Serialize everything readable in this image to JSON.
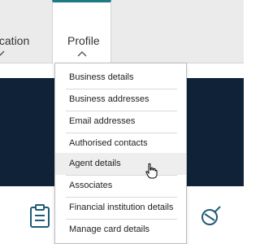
{
  "nav": {
    "tabs": [
      {
        "label": "nication"
      },
      {
        "label": "Profile"
      }
    ]
  },
  "dropdown": {
    "items": [
      {
        "label": "Business details"
      },
      {
        "label": "Business addresses"
      },
      {
        "label": "Email addresses"
      },
      {
        "label": "Authorised contacts"
      },
      {
        "label": "Agent details"
      },
      {
        "label": "Associates"
      },
      {
        "label": "Financial institution details"
      },
      {
        "label": "Manage card details"
      }
    ],
    "hovered_item": "Agent details"
  },
  "icons": {
    "tab_chevrons": [
      "chevron-down-icon",
      "chevron-up-icon"
    ],
    "lower": [
      "clipboard-icon",
      "search-icon"
    ],
    "cursor": "hand-pointer-icon"
  },
  "colors": {
    "active_tab_accent": "#1f7a85",
    "hero_background": "#0f2238",
    "nav_background": "#ebebeb",
    "menu_hover": "#eeeeee"
  }
}
